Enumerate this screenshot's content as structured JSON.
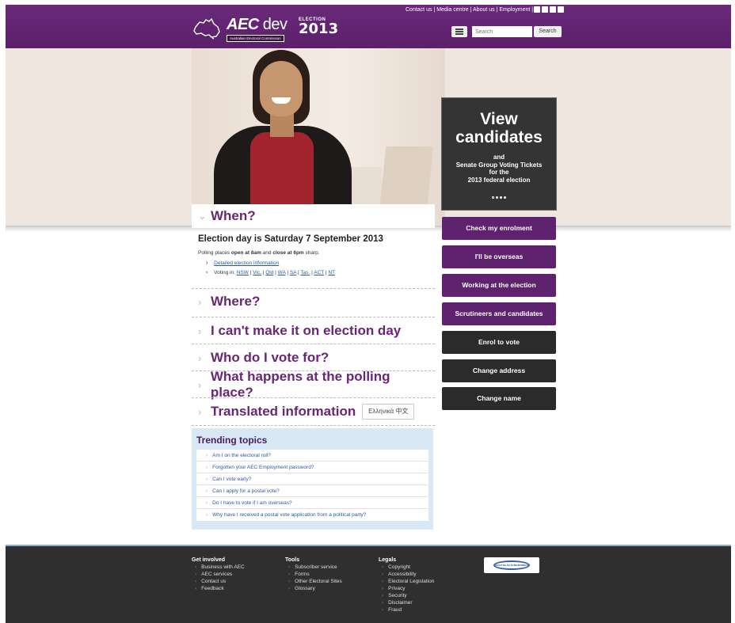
{
  "header": {
    "top_links": [
      "Contact us",
      "Media centre",
      "About us",
      "Employment"
    ],
    "separator": "|",
    "social_icons": [
      "twitter-icon",
      "facebook-icon",
      "youtube-icon",
      "rss-icon"
    ],
    "logo_title": "AEC",
    "logo_title_suffix": "dev",
    "logo_subtitle": "Australian Electoral Commission",
    "logo_election_label": "ELECTION",
    "logo_election_year": "2013",
    "search_placeholder": "Search",
    "search_button": "Search"
  },
  "promo": {
    "headline": "View candidates",
    "line1": "and",
    "line2": "Senate Group Voting Tickets",
    "line3": "for the",
    "line4": "2013 federal election",
    "slides_total": 4,
    "active_slide": 1
  },
  "side_buttons": [
    {
      "label": "Check my enrolment",
      "style": "purple"
    },
    {
      "label": "I'll be overseas",
      "style": "purple"
    },
    {
      "label": "Working at the election",
      "style": "purple"
    },
    {
      "label": "Scrutineers and candidates",
      "style": "purple"
    },
    {
      "label": "Enrol to vote",
      "style": "dark"
    },
    {
      "label": "Change address",
      "style": "dark"
    },
    {
      "label": "Change name",
      "style": "dark"
    }
  ],
  "when": {
    "title": "When?",
    "election_day": "Election day is Saturday 7 September 2013",
    "poll_prefix": "Polling places ",
    "poll_open": "open at 8am",
    "poll_mid": " and ",
    "poll_close": "close at 6pm",
    "poll_suffix": " sharp.",
    "detailed_link": "Detailed election information",
    "voting_in_label": "Voting in:",
    "states": [
      "NSW",
      "Vic.",
      "Qld",
      "WA",
      "SA",
      "Tas.",
      "ACT",
      "NT"
    ]
  },
  "sections": [
    "Where?",
    "I can't make it on election day",
    "Who do I vote for?",
    "What happens at the polling place?",
    "Translated information"
  ],
  "translation_box": "Ελληνικά  中文",
  "trending": {
    "title": "Trending topics",
    "items": [
      "Am I on the electoral roll?",
      "Forgotten your AEC Employment password?",
      "Can I vote early?",
      "Can I apply for a postal vote?",
      "Do I have to vote if I am overseas?",
      "Why have I received a postal vote application from a political party?"
    ]
  },
  "footer": {
    "get_involved": {
      "title": "Get involved",
      "items": [
        "Business with AEC",
        "AEC services",
        "Contact us",
        "Feedback"
      ]
    },
    "tools": {
      "title": "Tools",
      "items": [
        "Subscriber service",
        "Forms",
        "Other Electoral Sites",
        "Glossary"
      ]
    },
    "legals": {
      "title": "Legals",
      "items": [
        "Copyright",
        "Accessibility",
        "Electoral Legislation",
        "Privacy",
        "Security",
        "Disclaimer",
        "Fraud"
      ]
    },
    "badge_text": "Access to information"
  },
  "colors": {
    "brand_purple": "#5e226f",
    "dark_button": "#2b2b2b",
    "link_blue": "#2a5aa0",
    "footer_bg": "#2f2f2f"
  }
}
